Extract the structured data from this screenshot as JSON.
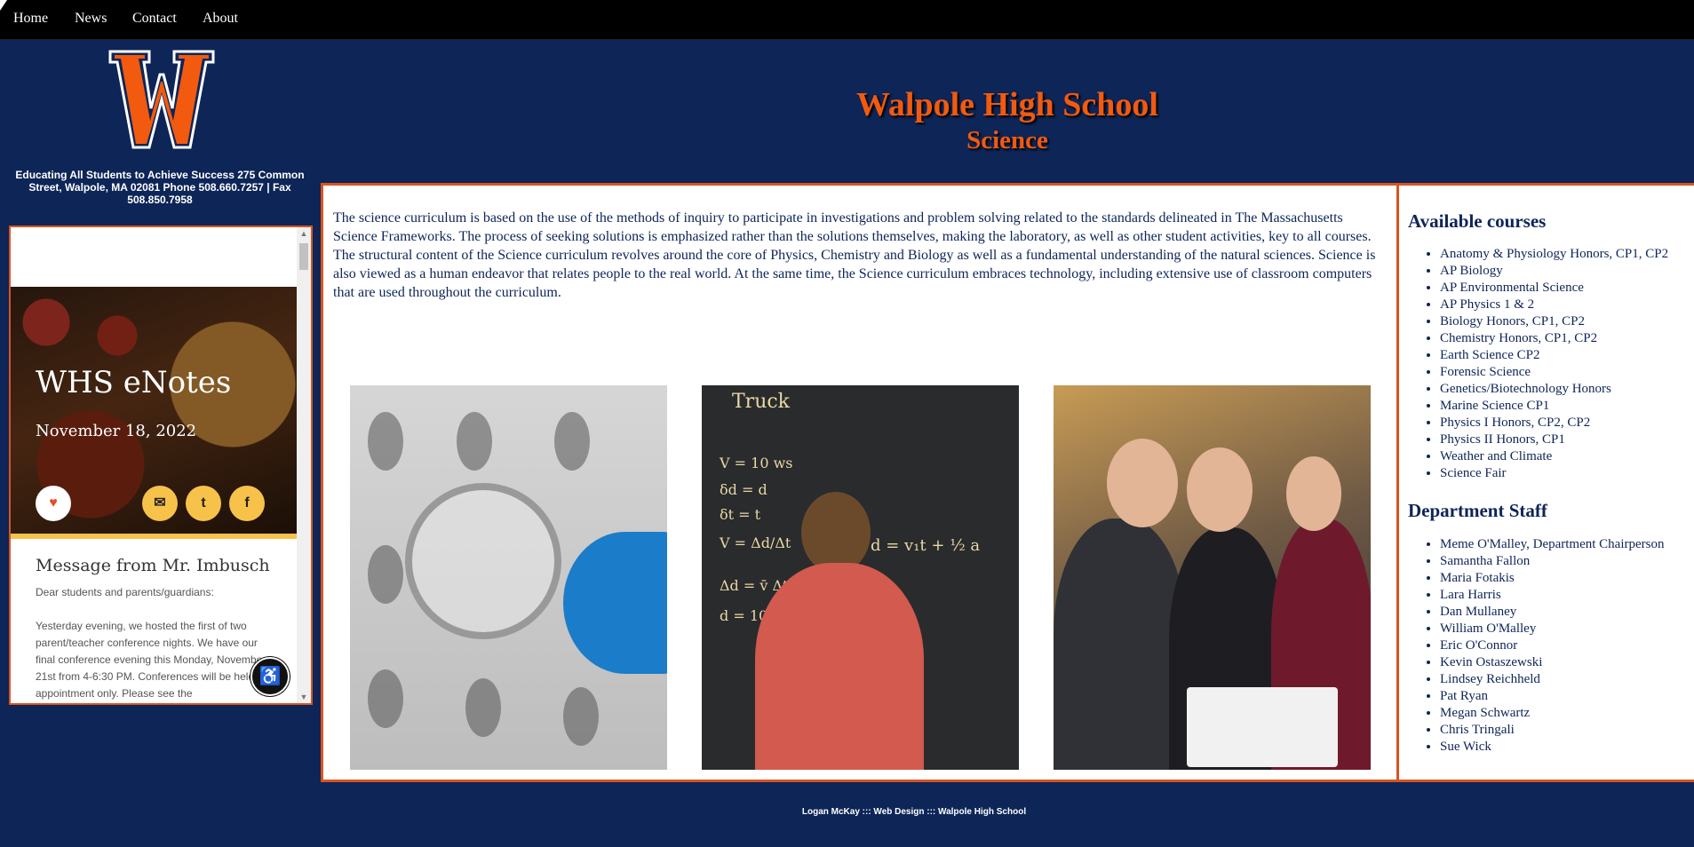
{
  "nav": {
    "items": [
      "Home",
      "News",
      "Contact",
      "About"
    ]
  },
  "school": {
    "logo_letter": "W",
    "tagline": "Educating All Students to Achieve Success 275 Common Street, Walpole, MA 02081 Phone 508.660.7257 | Fax 508.850.7958",
    "title": "Walpole High School",
    "department": "Science"
  },
  "enotes": {
    "title": "WHS eNotes",
    "date": "November 18, 2022",
    "message_title": "Message from Mr. Imbusch",
    "greeting": "Dear students and parents/guardians:",
    "body": "Yesterday evening, we hosted the first of two parent/teacher conference nights. We have our final conference evening this Monday, November 21st from 4-6:30 PM. Conferences will be held by appointment only. Please see the",
    "social_icons": [
      "heart-icon",
      "email-icon",
      "twitter-icon",
      "facebook-icon"
    ]
  },
  "main": {
    "intro": "The science curriculum is based on the use of the methods of inquiry to participate in investigations and problem solving related to the standards delineated in The Massachusetts Science Frameworks. The process of seeking solutions is emphasized rather than the solutions themselves, making the laboratory, as well as other student activities, key to all courses. The structural content of the Science curriculum revolves around the core of Physics, Chemistry and Biology as well as a fundamental understanding of the natural sciences. Science is also viewed as a human endeavor that relates people to the real world. At the same time, the Science curriculum embraces technology, including extensive use of classroom computers that are used throughout the curriculum.",
    "photo_board": {
      "truck_label": "Truck",
      "eq1": "V = 10 ws",
      "eq2": "δd = d",
      "eq3": "δt = t",
      "eq4": "V = Δd/Δt",
      "eq5": "Δd = v̄ Δt",
      "eq6": "d = v₁t + ½ a",
      "eq7": "d = 10 t"
    }
  },
  "sidebar": {
    "courses_heading": "Available courses",
    "courses": [
      "Anatomy & Physiology Honors, CP1, CP2",
      "AP Biology",
      "AP Environmental Science",
      "AP Physics 1 & 2",
      "Biology Honors, CP1, CP2",
      "Chemistry Honors, CP1, CP2",
      "Earth Science CP2",
      "Forensic Science",
      "Genetics/Biotechnology Honors",
      "Marine Science CP1",
      "Physics I Honors, CP2, CP2",
      "Physics II Honors, CP1",
      "Weather and Climate",
      "Science Fair"
    ],
    "staff_heading": "Department Staff",
    "staff": [
      "Meme O'Malley, Department Chairperson",
      "Samantha Fallon",
      "Maria Fotakis",
      "Lara Harris",
      "Dan Mullaney",
      "William O'Malley",
      "Eric O'Connor",
      "Kevin Ostaszewski",
      "Lindsey Reichheld",
      "Pat Ryan",
      "Megan Schwartz",
      "Chris Tringali",
      "Sue Wick"
    ]
  },
  "footer": {
    "text": "Logan McKay ::: Web Design ::: Walpole High School"
  },
  "colors": {
    "background": "#0d2557",
    "accent": "#f25a0f",
    "border": "#d9541e",
    "nav": "#000000"
  }
}
